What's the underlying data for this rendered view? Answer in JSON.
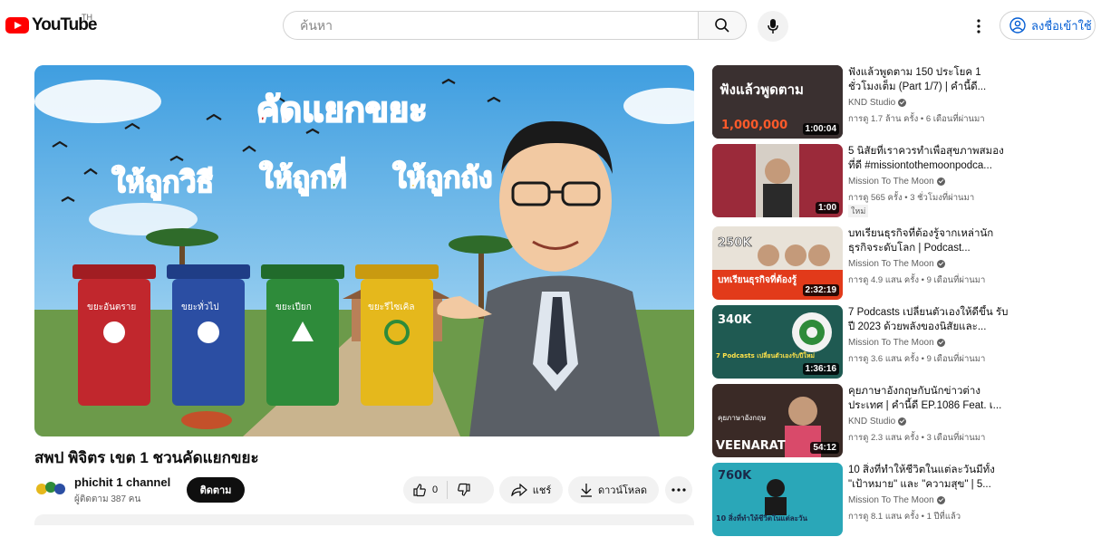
{
  "header": {
    "logo_text": "YouTube",
    "country_code": "TH",
    "search_placeholder": "ค้นหา",
    "signin_label": "ลงชื่อเข้าใช้"
  },
  "player": {
    "banner_title": "คัดแยกขยะ",
    "slogans": [
      "ให้ถูกวิธี",
      "ให้ถูกที่",
      "ให้ถูกถัง"
    ],
    "bins": [
      {
        "label": "ขยะอันตราย",
        "color": "#c1272d"
      },
      {
        "label": "ขยะทั่วไป",
        "color": "#2b4ea3"
      },
      {
        "label": "ขยะเปียก",
        "color": "#2e8b3a"
      },
      {
        "label": "ขยะรีไซเคิล",
        "color": "#e5b81c"
      }
    ]
  },
  "video": {
    "title": "สพป พิจิตร เขต 1 ชวนคัดแยกขยะ",
    "channel_name": "phichit 1 channel",
    "subscribers": "ผู้ติดตาม 387 คน",
    "subscribe_label": "ติดตาม",
    "like_count": "0",
    "share_label": "แชร์",
    "download_label": "ดาวน์โหลด"
  },
  "recommendations": [
    {
      "title": "ฟังแล้วพูดตาม 150 ประโยค 1 ชั่วโมงเต็ม (Part 1/7) | คำนี้ดี...",
      "channel": "KND Studio",
      "meta": "การดู 1.7 ล้าน ครั้ง • 6 เดือนที่ผ่านมา",
      "duration": "1:00:04",
      "thumb_text": "ฟังแล้วพูดตาม",
      "thumb_sub": "1,000,000",
      "badge": ""
    },
    {
      "title": "5 นิสัยที่เราควรทำเพื่อสุขภาพสมอง ที่ดี #missiontothemoonpodca...",
      "channel": "Mission To The Moon",
      "meta": "การดู 565 ครั้ง • 3 ชั่วโมงที่ผ่านมา",
      "duration": "1:00",
      "thumb_text": "",
      "thumb_sub": "",
      "badge": "ใหม่"
    },
    {
      "title": "บทเรียนธุรกิจที่ต้องรู้จากเหล่านัก ธุรกิจระดับโลก | Podcast...",
      "channel": "Mission To The Moon",
      "meta": "การดู 4.9 แสน ครั้ง • 9 เดือนที่ผ่านมา",
      "duration": "2:32:19",
      "thumb_text": "250K",
      "thumb_sub": "บทเรียนธุรกิจที่ต้องรู้",
      "badge": ""
    },
    {
      "title": "7 Podcasts เปลี่ยนตัวเองให้ดีขึ้น รับปี 2023 ด้วยพลังของนิสัยและ...",
      "channel": "Mission To The Moon",
      "meta": "การดู 3.6 แสน ครั้ง • 9 เดือนที่ผ่านมา",
      "duration": "1:36:16",
      "thumb_text": "340K",
      "thumb_sub": "7 Podcasts เปลี่ยนตัวเองรับปีใหม่",
      "badge": ""
    },
    {
      "title": "คุยภาษาอังกฤษกับนักข่าวต่าง ประเทศ | คำนี้ดี EP.1086 Feat. เ...",
      "channel": "KND Studio",
      "meta": "การดู 2.3 แสน ครั้ง • 3 เดือนที่ผ่านมา",
      "duration": "54:12",
      "thumb_text": "VEENARAT",
      "thumb_sub": "คุยภาษาอังกฤษ",
      "badge": ""
    },
    {
      "title": "10 สิ่งที่ทำให้ชีวิตในแต่ละวันมีทั้ง \"เป้าหมาย\" และ \"ความสุข\" | 5...",
      "channel": "Mission To The Moon",
      "meta": "การดู 8.1 แสน ครั้ง • 1 ปีที่แล้ว",
      "duration": "",
      "thumb_text": "760K",
      "thumb_sub": "10 สิ่งที่ทำให้ชีวิตในแต่ละวัน",
      "badge": ""
    }
  ]
}
